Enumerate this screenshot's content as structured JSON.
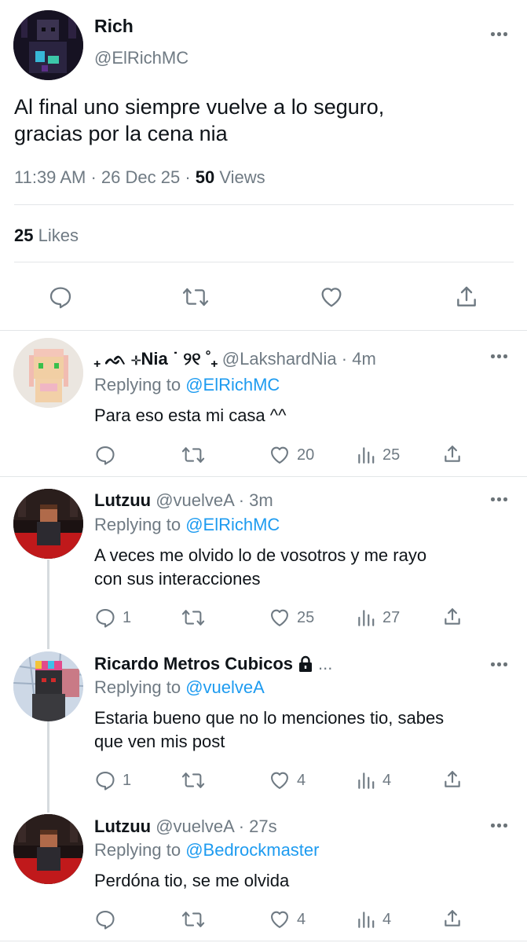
{
  "main_tweet": {
    "author_name": "Rich",
    "handle": "@ElRichMC",
    "text_line1": "Al final uno siempre vuelve a lo seguro,",
    "text_line2": "gracias por la cena nia",
    "time": "11:39 AM",
    "separator": "·",
    "date": "26 Dec 25",
    "views_count": "50",
    "views_label": "Views",
    "likes_count": "25",
    "likes_label": "Likes"
  },
  "replies": [
    {
      "author_name": "₊ ᨒ ⊹Nia ˙ ୨୧ ˚₊",
      "handle": "@LakshardNia",
      "time": "· 4m",
      "replying_prefix": "Replying to",
      "replying_to": "@ElRichMC",
      "text": "Para eso esta mi casa ^^",
      "replies_count": "",
      "likes": "20",
      "views": "25"
    },
    {
      "author_name": "Lutzuu",
      "handle": "@vuelveA",
      "time": "· 3m",
      "replying_prefix": "Replying to",
      "replying_to": "@ElRichMC",
      "text_line1": "A veces me olvido lo de vosotros y me rayo",
      "text_line2": "con sus interacciones",
      "replies_count": "1",
      "likes": "25",
      "views": "27"
    },
    {
      "author_name": "Ricardo Metros Cubicos",
      "ellipsis": "...",
      "replying_prefix": "Replying to",
      "replying_to": "@vuelveA",
      "text_line1": "Estaria bueno que no lo menciones tio, sabes",
      "text_line2": "que ven mis post",
      "replies_count": "1",
      "likes": "4",
      "views": "4"
    },
    {
      "author_name": "Lutzuu",
      "handle": "@vuelveA",
      "time": "· 27s",
      "replying_prefix": "Replying to",
      "replying_to": "@Bedrockmaster",
      "text": "Perdóna tio, se me olvida",
      "replies_count": "",
      "likes": "4",
      "views": "4"
    }
  ],
  "icons": {
    "reply": "speech-bubble-icon",
    "retweet": "retweet-icon",
    "like": "heart-icon",
    "views": "bar-chart-icon",
    "share": "share-upload-icon",
    "more": "more-dots-icon",
    "lock": "lock-icon"
  },
  "colors": {
    "link": "#1d9bf0",
    "muted": "#6f7a83",
    "text": "#0f1419"
  }
}
